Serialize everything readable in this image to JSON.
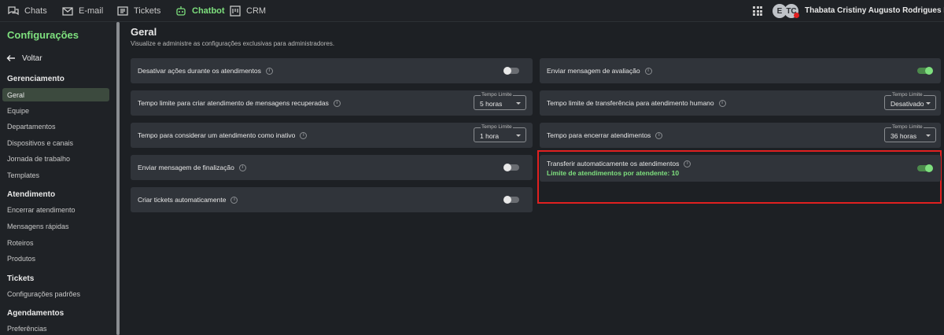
{
  "topnav": {
    "chats": "Chats",
    "email": "E-mail",
    "tickets": "Tickets",
    "chatbot": "Chatbot",
    "crm": "CRM",
    "avatar1": "E",
    "avatar2": "TC",
    "username": "Thabata Cristiny Augusto Rodrigues Moura"
  },
  "sidebar": {
    "title": "Configurações",
    "back": "Voltar",
    "sections": {
      "gerenciamento": "Gerenciamento",
      "atendimento": "Atendimento",
      "tickets": "Tickets",
      "agendamentos": "Agendamentos"
    },
    "items": {
      "geral": "Geral",
      "equipe": "Equipe",
      "departamentos": "Departamentos",
      "dispositivos": "Dispositivos e canais",
      "jornada": "Jornada de trabalho",
      "templates": "Templates",
      "encerrar": "Encerrar atendimento",
      "mensagens": "Mensagens rápidas",
      "roteiros": "Roteiros",
      "produtos": "Produtos",
      "config_padroes": "Configurações padrões",
      "preferencias": "Preferências"
    }
  },
  "main": {
    "title": "Geral",
    "subtitle": "Visualize e administre as configurações exclusivas para administradores.",
    "settings": {
      "desativar_acoes": "Desativar ações durante os atendimentos",
      "tempo_limite_recuperadas": "Tempo limite para criar atendimento de mensagens recuperadas",
      "tempo_inativo": "Tempo para considerar um atendimento como inativo",
      "msg_finalizacao": "Enviar mensagem de finalização",
      "criar_tickets": "Criar tickets automaticamente",
      "msg_avaliacao": "Enviar mensagem de avaliação",
      "tempo_transferencia": "Tempo limite de transferência para atendimento humano",
      "tempo_encerrar": "Tempo para encerrar atendimentos",
      "transferir_auto": "Transferir automaticamente os atendimentos",
      "limite_atendimentos": "Limite de atendimentos por atendente: 10"
    },
    "select_legend": "Tempo Limite",
    "select_values": {
      "recuperadas": "5 horas",
      "inativo": "1 hora",
      "transferencia": "Desativado",
      "encerrar": "36 horas"
    }
  },
  "colors": {
    "accent": "#7ee07e",
    "highlight": "#e02020",
    "card": "#30343a",
    "background": "#1d2024"
  }
}
